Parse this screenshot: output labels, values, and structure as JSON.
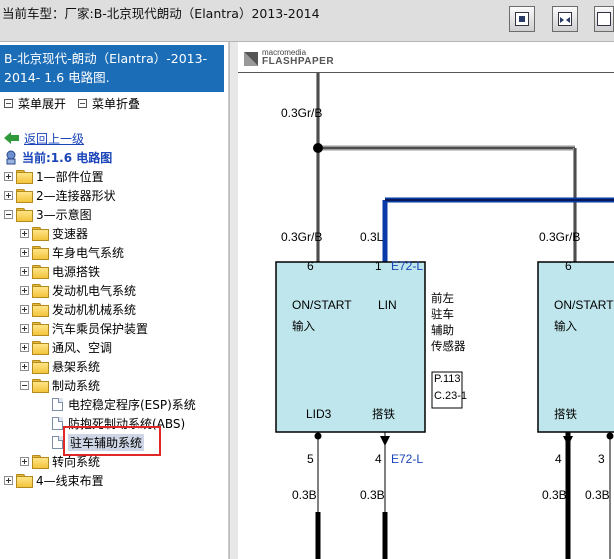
{
  "topbar": {
    "title": "当前车型：厂家:B-北京现代朗动（Elantra）2013-2014"
  },
  "doc_title": "B-北京现代-朗动（Elantra）-2013-2014- 1.6 电路图.",
  "menu": {
    "expand": "菜单展开",
    "collapse": "菜单折叠"
  },
  "nav": {
    "back": "返回上一级",
    "current": "当前:1.6 电路图"
  },
  "tree": {
    "n1": "1—部件位置",
    "n2": "2—连接器形状",
    "n3": "3—示意图",
    "n3_children": [
      "变速器",
      "车身电气系统",
      "电源搭铁",
      "发动机电气系统",
      "发动机机械系统",
      "汽车乘员保护装置",
      "通风、空调",
      "悬架系统"
    ],
    "n3_brake": "制动系统",
    "brake_children": [
      "电控稳定程序(ESP)系统",
      "防抱死制动系统(ABS)",
      "驻车辅助系统"
    ],
    "n3_steer": "转向系统",
    "n4": "4—线束布置"
  },
  "diagram": {
    "logo_top": "macromedia",
    "logo_bottom": "FLASHPAPER",
    "wire_top_left": "0.3Gr/B",
    "wire_mid_left": "0.3Gr/B",
    "wire_mid_center": "0.3L",
    "wire_mid_right": "0.3Gr/B",
    "pin_6": "6",
    "pin_1": "1",
    "pin_6b": "6",
    "connector_top": "E72-L",
    "box1_on_start": "ON/START",
    "box1_input": "输入",
    "box1_lin": "LIN",
    "box1_lid3": "LID3",
    "box1_ground": "搭铁",
    "sensor_name": [
      "前左",
      "驻车",
      "辅助",
      "传感器"
    ],
    "ref_p": "P.113",
    "ref_c": "C.23-1",
    "box2_on_start": "ON/START",
    "box2_input": "输入",
    "box2_ground": "搭铁",
    "pin_5": "5",
    "pin_4": "4",
    "pin_4b": "4",
    "pin_3": "3",
    "connector_bottom": "E72-L",
    "wire_bot_1": "0.3B",
    "wire_bot_2": "0.3B",
    "wire_bot_3": "0.3B",
    "wire_bot_4": "0.3B"
  }
}
